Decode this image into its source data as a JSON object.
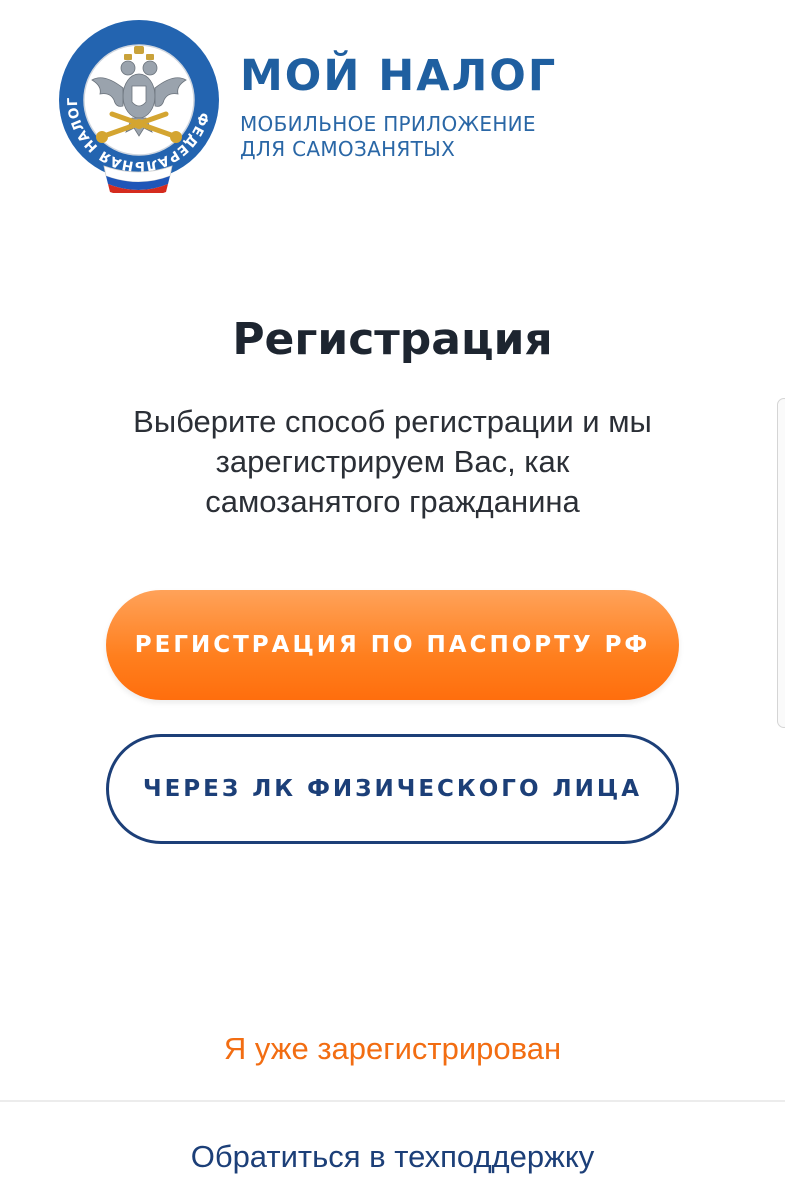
{
  "header": {
    "logo": {
      "icon": "fns-emblem-icon",
      "ring_text": "ФЕДЕРАЛЬНАЯ НАЛОГОВАЯ СЛУЖБА",
      "colors": {
        "ring": "#2364b0",
        "gold": "#d4a531",
        "flag_white": "#ffffff",
        "flag_blue": "#1f56b8",
        "flag_red": "#d52b1e"
      }
    },
    "app_name": "МОЙ НАЛОГ",
    "subtitle_line1": "МОБИЛЬНОЕ ПРИЛОЖЕНИЕ",
    "subtitle_line2": "ДЛЯ САМОЗАНЯТЫХ"
  },
  "main": {
    "title": "Регистрация",
    "description": "Выберите способ регистрации и мы зарегистрируем Вас, как самозанятого гражданина",
    "primary_button": "РЕГИСТРАЦИЯ ПО ПАСПОРТУ РФ",
    "secondary_button": "ЧЕРЕЗ ЛК ФИЗИЧЕСКОГО ЛИЦА"
  },
  "footer": {
    "already_registered": "Я уже зарегистрирован",
    "support": "Обратиться в техподдержку"
  },
  "colors": {
    "brand_blue": "#1f5fa0",
    "accent_orange": "#ff7f1e",
    "link_orange": "#f26d12",
    "navy": "#1c3f78",
    "title_dark": "#1d2530"
  }
}
